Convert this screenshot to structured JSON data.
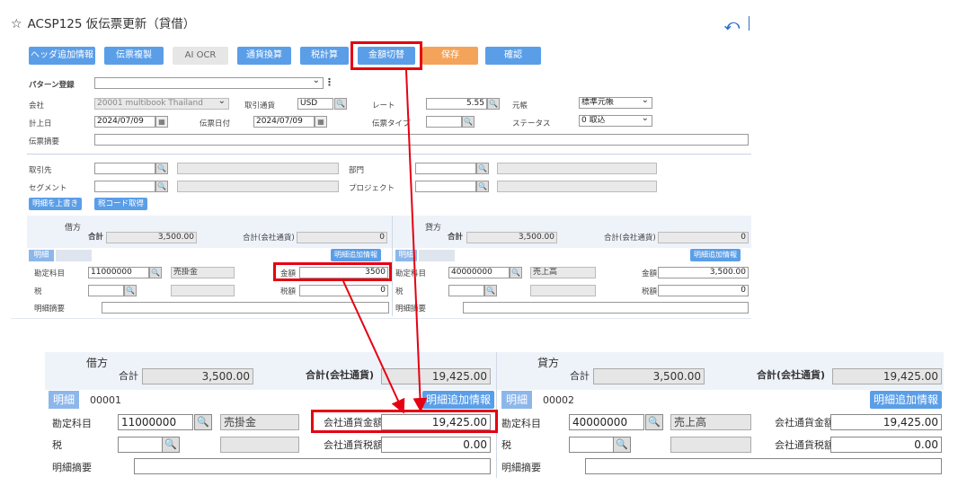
{
  "header": {
    "title": "ACSP125 仮伝票更新（貸借）"
  },
  "toolbar": {
    "header_info": "ヘッダ追加情報",
    "copy_slip": "伝票複製",
    "ai_ocr": "AI OCR",
    "currency_convert": "通貨換算",
    "tax_calc": "税計算",
    "amount_switch": "金額切替",
    "save": "保存",
    "confirm": "確認"
  },
  "form": {
    "pattern_label": "パターン登録",
    "company_label": "会社",
    "company_value": "20001 multibook Thailand",
    "trade_currency_label": "取引通貨",
    "trade_currency_value": "USD",
    "rate_label": "レート",
    "rate_value": "5.55",
    "ledger_label": "元帳",
    "ledger_value": "標準元帳",
    "posting_date_label": "計上日",
    "posting_date_value": "2024/07/09",
    "slip_date_label": "伝票日付",
    "slip_date_value": "2024/07/09",
    "slip_type_label": "伝票タイプ",
    "status_label": "ステータス",
    "status_value": "0 取込",
    "memo_label": "伝票摘要",
    "partner_label": "取引先",
    "dept_label": "部門",
    "segment_label": "セグメント",
    "project_label": "プロジェクト",
    "overwrite_btn": "明細を上書き",
    "taxcode_btn": "税コード取得"
  },
  "small": {
    "debit": "借方",
    "credit": "貸方",
    "total_label": "合計",
    "total_value": "3,500.00",
    "company_total_label": "合計(会社通貨)",
    "company_total_value": "0",
    "detail_tag": "明細",
    "detail_info_btn": "明細追加情報",
    "account_label": "勘定科目",
    "debit_account_code": "11000000",
    "debit_account_name": "売掛金",
    "credit_account_code": "40000000",
    "credit_account_name": "売上高",
    "amount_label": "金額",
    "debit_amount": "3500",
    "credit_amount": "3,500.00",
    "tax_label": "税",
    "tax_amount_label": "税額",
    "tax_amount": "0",
    "line_memo_label": "明細摘要"
  },
  "zoom": {
    "debit": "借方",
    "credit": "貸方",
    "total_label": "合計",
    "total_value": "3,500.00",
    "company_total_label": "合計(会社通貨)",
    "company_total_value": "19,425.00",
    "detail_tag": "明細",
    "debit_line_no": "00001",
    "credit_line_no": "00002",
    "detail_info_btn": "明細追加情報",
    "account_label": "勘定科目",
    "debit_account_code": "11000000",
    "debit_account_name": "売掛金",
    "credit_account_code": "40000000",
    "credit_account_name": "売上高",
    "company_amount_label": "会社通貨金額",
    "company_amount_value": "19,425.00",
    "company_tax_label": "会社通貨税額",
    "company_tax_value": "0.00",
    "tax_label": "税",
    "line_memo_label": "明細摘要"
  },
  "colors": {
    "accent_blue": "#5b9ee8",
    "save_orange": "#f4a45a",
    "highlight_red": "#e60012"
  }
}
